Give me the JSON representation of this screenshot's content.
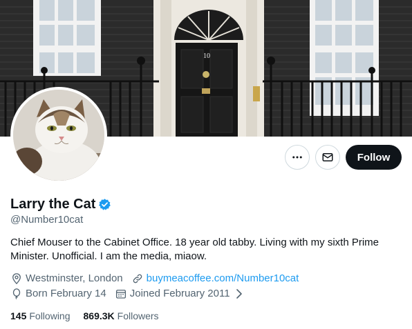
{
  "profile": {
    "display_name": "Larry the Cat",
    "handle": "@Number10cat",
    "bio": "Chief Mouser to the Cabinet Office. 18 year old tabby. Living with my sixth Prime Minister. Unofficial. I am the media, miaow.",
    "location": "Westminster, London",
    "website": "buymeacoffee.com/Number10cat",
    "birthday": "Born February 14",
    "joined": "Joined February 2011",
    "following_count": "145",
    "following_label": "Following",
    "followers_count": "869.3K",
    "followers_label": "Followers"
  },
  "banner": {
    "door_number": "10"
  },
  "actions": {
    "follow_label": "Follow"
  },
  "icons": {
    "more": "more-dots-icon",
    "message": "envelope-icon",
    "verified": "verified-badge-icon",
    "location": "location-pin-icon",
    "link": "link-icon",
    "birthday": "balloon-icon",
    "joined": "calendar-icon",
    "chevron": "chevron-right-icon"
  },
  "colors": {
    "accent": "#1d9bf0",
    "primary_text": "#0f1419",
    "secondary_text": "#536471",
    "follow_bg": "#0f1419",
    "border": "#cfd9de"
  }
}
